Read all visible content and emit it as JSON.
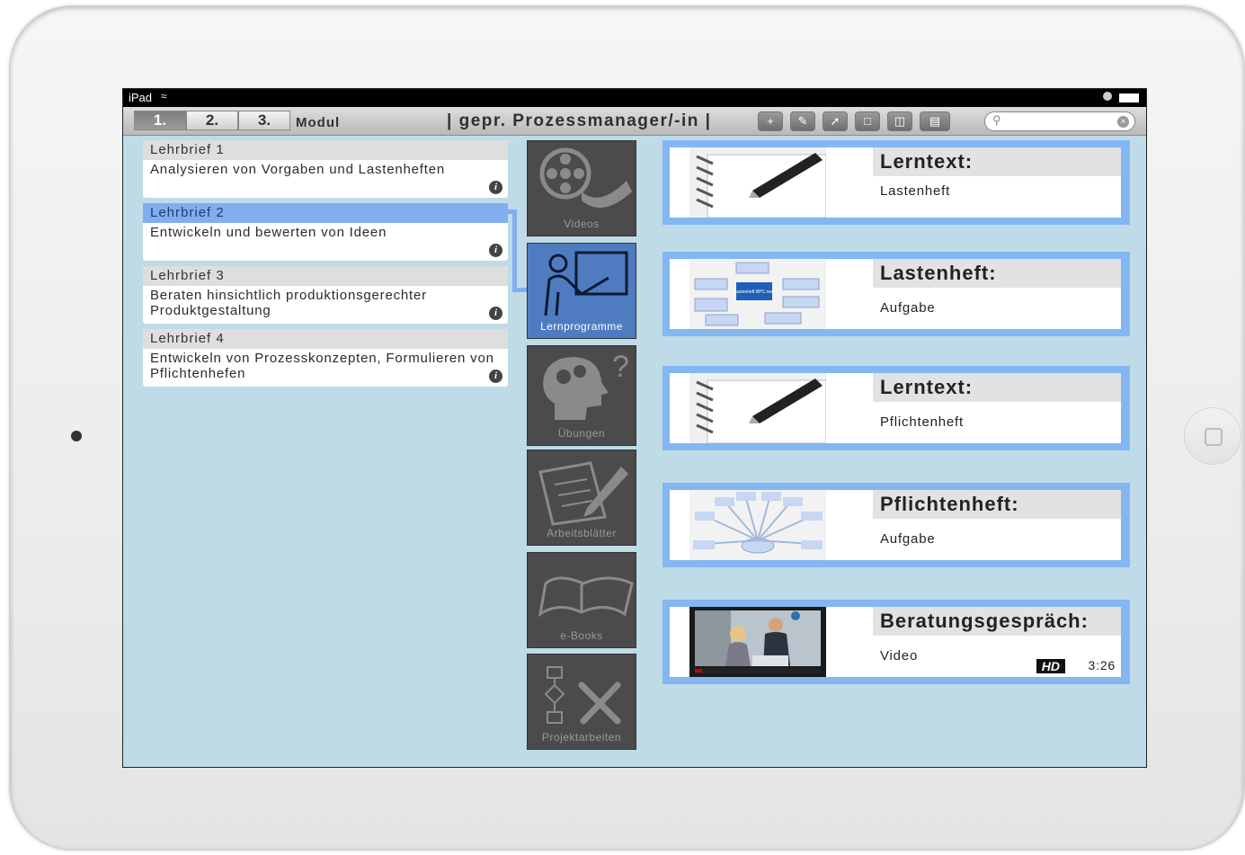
{
  "status": {
    "carrier": "iPad"
  },
  "toolbar": {
    "tabs": [
      "1.",
      "2.",
      "3."
    ],
    "active_tab": 0,
    "modul_label": "Modul",
    "title": "| gepr. Prozessmanager/-in |",
    "buttons": [
      "add-icon",
      "edit-icon",
      "share-icon",
      "folder-icon",
      "trash-icon",
      "book-icon"
    ],
    "search_placeholder": ""
  },
  "lehrbriefe": [
    {
      "title": "Lehrbrief 1",
      "text": "Analysieren von Vorgaben und Lastenheften",
      "selected": false
    },
    {
      "title": "Lehrbrief 2",
      "text": "Entwickeln und bewerten von Ideen",
      "selected": true
    },
    {
      "title": "Lehrbrief 3",
      "text": "Beraten hinsichtlich produktionsgerechter Produktgestaltung",
      "selected": false
    },
    {
      "title": "Lehrbrief 4",
      "text": "Entwickeln von Prozesskonzepten, Formulieren von Pflichtenhefen",
      "selected": false
    }
  ],
  "categories": [
    {
      "label": "Videos",
      "icon": "film-reel-icon",
      "active": false
    },
    {
      "label": "Lernprogramme",
      "icon": "teacher-board-icon",
      "active": true
    },
    {
      "label": "Übungen",
      "icon": "head-gears-icon",
      "active": false
    },
    {
      "label": "Arbeitsblätter",
      "icon": "paper-pen-icon",
      "active": false
    },
    {
      "label": "e-Books",
      "icon": "open-book-icon",
      "active": false
    },
    {
      "label": "Projektarbeiten",
      "icon": "flowchart-tools-icon",
      "active": false
    }
  ],
  "cards": [
    {
      "title": "Lerntext:",
      "sub": "Lastenheft",
      "thumb": "notebook"
    },
    {
      "title": "Lastenheft:",
      "sub": "Aufgabe",
      "thumb": "diagram",
      "thumb_center": "Lastenheft BPC.new"
    },
    {
      "title": "Lerntext:",
      "sub": "Pflichtenheft",
      "thumb": "notebook"
    },
    {
      "title": "Pflichtenheft:",
      "sub": "Aufgabe",
      "thumb": "radial"
    },
    {
      "title": "Beratungsgespräch:",
      "sub": "Video",
      "thumb": "video",
      "badge": "HD",
      "duration": "3:26"
    }
  ],
  "colors": {
    "screen_bg": "#bedbe7",
    "accent": "#84b7f2",
    "active_category": "#4f7cc0"
  }
}
